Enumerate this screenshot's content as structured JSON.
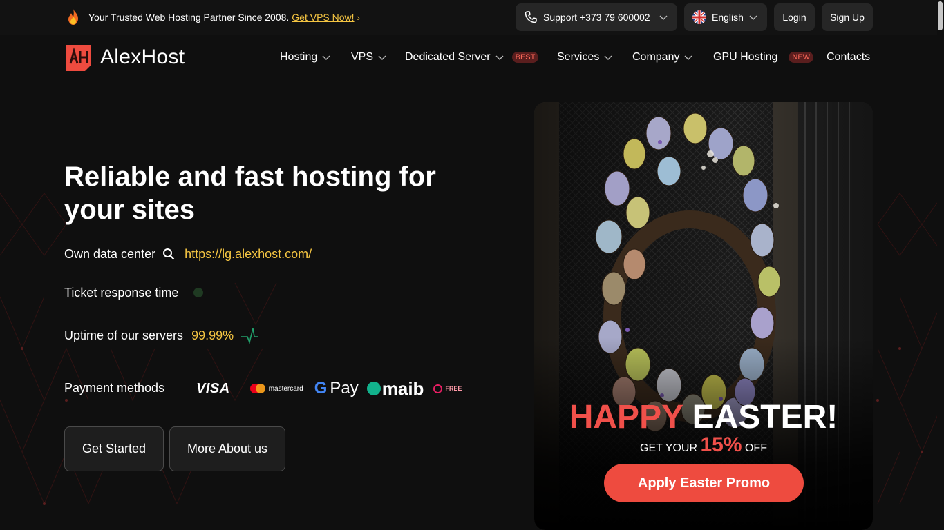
{
  "topbar": {
    "promo_text": "Your Trusted Web Hosting Partner Since 2008.",
    "promo_link": "Get VPS Now!",
    "support_label": "Support +373 79 600002",
    "language_label": "English",
    "login_label": "Login",
    "signup_label": "Sign Up"
  },
  "brand": {
    "name": "AlexHost",
    "accent": "#ee4b3f"
  },
  "nav": {
    "items": [
      {
        "label": "Hosting"
      },
      {
        "label": "VPS"
      },
      {
        "label": "Dedicated Server",
        "badge": "BEST"
      },
      {
        "label": "Services"
      },
      {
        "label": "Company"
      },
      {
        "label": "GPU Hosting",
        "badge": "NEW"
      },
      {
        "label": "Contacts"
      }
    ]
  },
  "hero": {
    "title": "Reliable and fast hosting for your sites",
    "datacenter_label": "Own data center",
    "datacenter_link": "https://lg.alexhost.com/",
    "ticket_label": "Ticket response time",
    "uptime_label": "Uptime of our servers",
    "uptime_value": "99.99%",
    "payment_label": "Payment methods",
    "payment_logos": {
      "visa": "VISA",
      "mastercard": "mastercard",
      "gpay": "Pay",
      "maib": "maib",
      "free": "FREE"
    },
    "get_started": "Get Started",
    "more_about": "More About us"
  },
  "easter": {
    "title_red": "HAPPY",
    "title_white": "EASTER!",
    "sub_before": "GET YOUR",
    "sub_percent": "15%",
    "sub_after": "OFF",
    "button": "Apply Easter Promo"
  }
}
